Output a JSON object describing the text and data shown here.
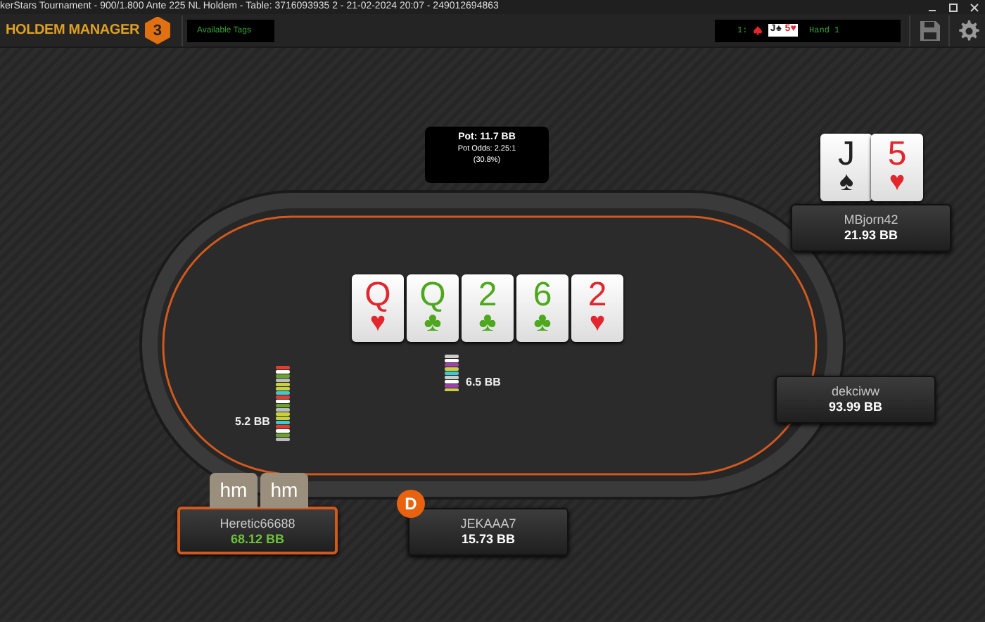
{
  "window": {
    "title": "kerStars Tournament - 900/1.800 Ante 225 NL Holdem - Table: 3716093935 2 - 21-02-2024 20:07 - 249012694863"
  },
  "toolbar": {
    "logo_text": "HOLDEM MANAGER",
    "logo_badge": "3",
    "tags_label": "Available Tags",
    "hand_summary": {
      "prefix": "1:",
      "label": "Hand 1",
      "cards": [
        {
          "rank": "J",
          "suit": "♠",
          "color": "#222222"
        },
        {
          "rank": "5",
          "suit": "♥",
          "color": "#e3262e"
        }
      ]
    }
  },
  "pot": {
    "pot": "Pot: 11.7 BB",
    "odds": "Pot Odds: 2.25:1",
    "percent": "(30.8%)"
  },
  "board": [
    {
      "rank": "Q",
      "suit": "♥",
      "color": "#e3262e"
    },
    {
      "rank": "Q",
      "suit": "♣",
      "color": "#4ea81e"
    },
    {
      "rank": "2",
      "suit": "♣",
      "color": "#4ea81e"
    },
    {
      "rank": "6",
      "suit": "♣",
      "color": "#4ea81e"
    },
    {
      "rank": "2",
      "suit": "♥",
      "color": "#e3262e"
    }
  ],
  "bets": [
    {
      "amount": "5.2 BB"
    },
    {
      "amount": "6.5 BB"
    }
  ],
  "seats": [
    {
      "name": "MBjorn42",
      "stack": "21.93 BB",
      "selected": false,
      "dealer": false,
      "hole_cards": [
        {
          "rank": "J",
          "suit": "♠",
          "color": "#222222"
        },
        {
          "rank": "5",
          "suit": "♥",
          "color": "#e3262e"
        }
      ]
    },
    {
      "name": "dekciww",
      "stack": "93.99 BB",
      "selected": false,
      "dealer": false
    },
    {
      "name": "Heretic66688",
      "stack": "68.12 BB",
      "selected": true,
      "dealer": false,
      "hud_tabs": [
        "hm",
        "hm"
      ]
    },
    {
      "name": "JEKAAA7",
      "stack": "15.73 BB",
      "selected": false,
      "dealer": true,
      "dealer_label": "D"
    }
  ]
}
